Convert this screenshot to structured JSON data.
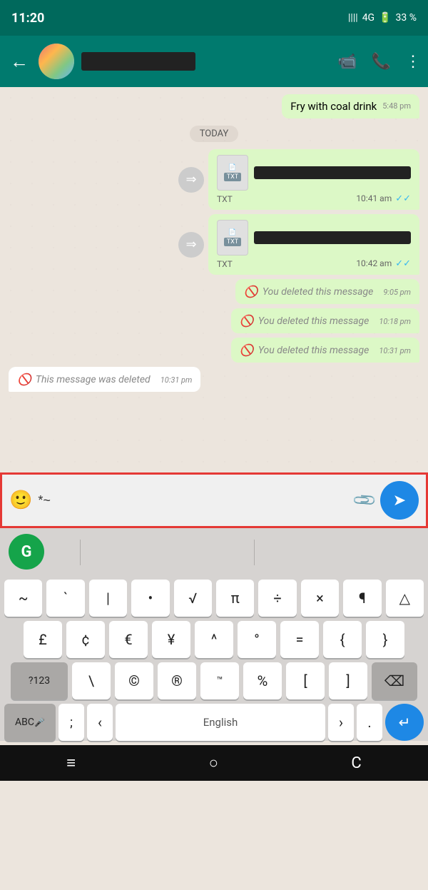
{
  "statusBar": {
    "time": "11:20",
    "signal": "4G",
    "battery": "33 %"
  },
  "header": {
    "backLabel": "←",
    "contactName": "[redacted]",
    "videoIcon": "📹",
    "callIcon": "📞",
    "menuIcon": "⋮"
  },
  "chat": {
    "prevMessage": "Fry with coal drink",
    "prevTime": "5:48 pm",
    "dateSeparator": "TODAY",
    "messages": [
      {
        "type": "sent",
        "hasForward": true,
        "fileType": "TXT",
        "fileName": "[redacted]",
        "time": "10:41 am",
        "ticks": "✓✓"
      },
      {
        "type": "sent",
        "hasForward": true,
        "fileType": "TXT",
        "fileName": "[redacted]",
        "time": "10:42 am",
        "ticks": "✓✓"
      },
      {
        "type": "sent",
        "deleted": true,
        "text": "You deleted this message",
        "time": "9:05 pm"
      },
      {
        "type": "sent",
        "deleted": true,
        "text": "You deleted this message",
        "time": "10:18 pm"
      },
      {
        "type": "sent",
        "deleted": true,
        "text": "You deleted this message",
        "time": "10:31 pm"
      },
      {
        "type": "received",
        "deleted": true,
        "text": "This message was deleted",
        "time": "10:31 pm"
      }
    ]
  },
  "inputArea": {
    "emojiIcon": "🙂",
    "text": "*~",
    "attachIcon": "📎",
    "sendIcon": "➤"
  },
  "grammarly": {
    "label": "G"
  },
  "keyboard": {
    "row1": [
      "~",
      "`",
      "|",
      "•",
      "√",
      "π",
      "÷",
      "×",
      "¶",
      "△"
    ],
    "row2": [
      "£",
      "¢",
      "€",
      "¥",
      "^",
      "°",
      "=",
      "{",
      "}"
    ],
    "row3Left": "?123",
    "row3": [
      "\\",
      "©",
      "®",
      "™",
      "%",
      "[",
      "]"
    ],
    "row3Right": "⌫",
    "row4Left": "ABC",
    "row4LeftSub": "🎤",
    "row4Punct1": ";",
    "row4Lt": "<",
    "row4Space": "English",
    "row4Gt": ">",
    "row4Dot": ".",
    "row4Enter": "↵"
  },
  "bottomNav": {
    "home": "≡",
    "circle": "○",
    "back": "C"
  }
}
